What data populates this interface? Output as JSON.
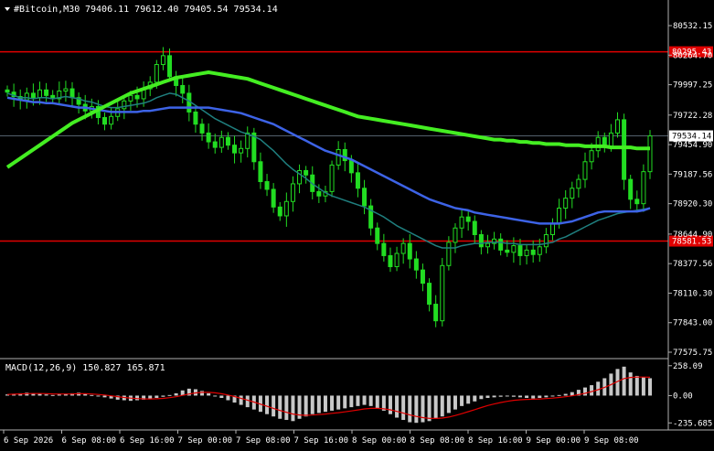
{
  "header": {
    "symbol": "#Bitcoin,M30",
    "ohlc": "79406.11 79612.40 79405.54 79534.14",
    "menu_icon": "triangle-down-icon"
  },
  "colors": {
    "background": "#000000",
    "grid": "#1c2a2a",
    "axis": "#b0b0b0",
    "text": "#ffffff",
    "candle": "#22dd22",
    "ma_fast": "#1f7f7f",
    "ma_mid": "#3d63e6",
    "ma_slow": "#44ee22",
    "hline": "#e00000",
    "price_label_bg": "#e00000",
    "macd_hist": "#c8c8c8",
    "macd_signal": "#e00000"
  },
  "chart_data": [
    {
      "type": "candlestick",
      "title": "#Bitcoin,M30",
      "y_ticks": [
        "80532.15",
        "80264.70",
        "79997.25",
        "79722.28",
        "79454.90",
        "79187.56",
        "78920.30",
        "78644.90",
        "78377.56",
        "78110.30",
        "77843.00",
        "77575.75"
      ],
      "ylim": [
        77575.75,
        80532.15
      ],
      "x_ticks": [
        "6 Sep 2026",
        "6 Sep 08:00",
        "6 Sep 16:00",
        "7 Sep 00:00",
        "7 Sep 08:00",
        "7 Sep 16:00",
        "8 Sep 00:00",
        "8 Sep 08:00",
        "8 Sep 16:00",
        "9 Sep 00:00",
        "9 Sep 08:00"
      ],
      "current_price": {
        "value": 79534.14,
        "label": "79534.14"
      },
      "horizontal_lines": [
        {
          "value": 80295.43,
          "label": "80295.43"
        },
        {
          "value": 78581.53,
          "label": "78581.53"
        }
      ],
      "price_path": [
        79930,
        79890,
        79860,
        79920,
        79880,
        79950,
        79900,
        79870,
        79940,
        79960,
        79880,
        79820,
        79760,
        79800,
        79700,
        79640,
        79710,
        79780,
        79850,
        79900,
        79870,
        79960,
        80020,
        80180,
        80260,
        80070,
        79990,
        79920,
        79750,
        79640,
        79560,
        79480,
        79430,
        79520,
        79450,
        79380,
        79420,
        79560,
        79300,
        79120,
        79050,
        78890,
        78810,
        78940,
        79100,
        79220,
        79180,
        79030,
        78990,
        79030,
        79270,
        79410,
        79310,
        79200,
        79060,
        78900,
        78700,
        78560,
        78450,
        78350,
        78470,
        78560,
        78420,
        78320,
        78200,
        78010,
        77860,
        78360,
        78570,
        78700,
        78800,
        78760,
        78640,
        78530,
        78560,
        78600,
        78500,
        78480,
        78540,
        78450,
        78500,
        78460,
        78530,
        78640,
        78740,
        78880,
        78970,
        79060,
        79140,
        79300,
        79400,
        79520,
        79440,
        79560,
        79680,
        79140,
        78960,
        78920,
        79210,
        79534
      ],
      "series": [
        {
          "name": "MA fast",
          "values": [
            79920,
            79900,
            79880,
            79880,
            79870,
            79880,
            79880,
            79870,
            79880,
            79890,
            79880,
            79870,
            79850,
            79840,
            79820,
            79800,
            79790,
            79790,
            79800,
            79810,
            79820,
            79830,
            79850,
            79880,
            79900,
            79920,
            79910,
            79880,
            79850,
            79810,
            79770,
            79730,
            79690,
            79660,
            79630,
            79600,
            79570,
            79550,
            79530,
            79500,
            79450,
            79400,
            79340,
            79280,
            79230,
            79190,
            79150,
            79100,
            79060,
            79020,
            78990,
            78970,
            78950,
            78930,
            78910,
            78890,
            78860,
            78830,
            78800,
            78760,
            78720,
            78690,
            78660,
            78630,
            78600,
            78570,
            78540,
            78520,
            78520,
            78520,
            78540,
            78550,
            78560,
            78560,
            78570,
            78570,
            78570,
            78560,
            78560,
            78550,
            78550,
            78550,
            78550,
            78560,
            78570,
            78600,
            78620,
            78650,
            78680,
            78710,
            78740,
            78770,
            78790,
            78810,
            78830,
            78840,
            78850,
            78860,
            78870,
            78880
          ]
        },
        {
          "name": "MA mid",
          "values": [
            79880,
            79870,
            79860,
            79850,
            79840,
            79840,
            79830,
            79830,
            79820,
            79810,
            79800,
            79790,
            79790,
            79780,
            79770,
            79760,
            79750,
            79750,
            79750,
            79750,
            79750,
            79760,
            79760,
            79770,
            79780,
            79790,
            79790,
            79790,
            79790,
            79790,
            79790,
            79790,
            79780,
            79770,
            79760,
            79750,
            79740,
            79720,
            79700,
            79680,
            79660,
            79640,
            79610,
            79580,
            79550,
            79520,
            79490,
            79460,
            79430,
            79400,
            79380,
            79360,
            79340,
            79320,
            79290,
            79260,
            79230,
            79200,
            79170,
            79140,
            79110,
            79080,
            79050,
            79020,
            78990,
            78960,
            78940,
            78920,
            78900,
            78880,
            78870,
            78860,
            78840,
            78830,
            78820,
            78810,
            78800,
            78790,
            78780,
            78770,
            78760,
            78750,
            78740,
            78740,
            78740,
            78740,
            78750,
            78760,
            78780,
            78800,
            78820,
            78840,
            78850,
            78850,
            78850,
            78850,
            78850,
            78850,
            78860,
            78880
          ]
        },
        {
          "name": "MA slow",
          "values": [
            79250,
            79290,
            79330,
            79370,
            79410,
            79450,
            79490,
            79530,
            79570,
            79610,
            79650,
            79680,
            79710,
            79740,
            79770,
            79800,
            79830,
            79860,
            79890,
            79920,
            79940,
            79960,
            79980,
            80000,
            80020,
            80040,
            80060,
            80070,
            80080,
            80090,
            80100,
            80110,
            80100,
            80090,
            80080,
            80070,
            80060,
            80050,
            80030,
            80010,
            79990,
            79970,
            79950,
            79930,
            79910,
            79890,
            79870,
            79850,
            79830,
            79810,
            79790,
            79770,
            79750,
            79730,
            79710,
            79700,
            79690,
            79680,
            79670,
            79660,
            79650,
            79640,
            79630,
            79620,
            79610,
            79600,
            79590,
            79580,
            79570,
            79560,
            79550,
            79540,
            79530,
            79520,
            79510,
            79500,
            79500,
            79490,
            79490,
            79480,
            79480,
            79470,
            79470,
            79460,
            79460,
            79460,
            79450,
            79450,
            79450,
            79440,
            79440,
            79440,
            79440,
            79430,
            79430,
            79430,
            79430,
            79420,
            79420,
            79420
          ]
        }
      ]
    },
    {
      "type": "bar",
      "title": "MACD(12,26,9) 150.827 165.871",
      "y_ticks": [
        "258.09",
        "0.00",
        "-235.685"
      ],
      "ylim": [
        -265,
        280
      ],
      "histogram": [
        10,
        15,
        20,
        25,
        20,
        15,
        10,
        5,
        10,
        15,
        20,
        25,
        15,
        5,
        -5,
        -15,
        -25,
        -35,
        -40,
        -45,
        -40,
        -35,
        -30,
        -20,
        -10,
        5,
        20,
        45,
        60,
        55,
        40,
        20,
        0,
        -20,
        -40,
        -60,
        -80,
        -100,
        -120,
        -140,
        -160,
        -180,
        -200,
        -210,
        -220,
        -200,
        -180,
        -160,
        -150,
        -140,
        -130,
        -120,
        -110,
        -100,
        -90,
        -80,
        -90,
        -110,
        -130,
        -160,
        -190,
        -210,
        -230,
        -235,
        -230,
        -220,
        -200,
        -180,
        -150,
        -120,
        -90,
        -70,
        -50,
        -30,
        -20,
        -15,
        -10,
        -5,
        -10,
        -15,
        -20,
        -25,
        -20,
        -15,
        -5,
        5,
        15,
        30,
        50,
        70,
        90,
        120,
        150,
        190,
        230,
        250,
        200,
        170,
        160,
        150
      ],
      "signal": [
        10,
        12,
        15,
        17,
        18,
        18,
        17,
        15,
        14,
        14,
        15,
        17,
        16,
        14,
        10,
        5,
        -2,
        -9,
        -16,
        -22,
        -26,
        -28,
        -29,
        -27,
        -24,
        -18,
        -10,
        2,
        14,
        23,
        28,
        28,
        24,
        16,
        5,
        -8,
        -23,
        -39,
        -56,
        -74,
        -92,
        -110,
        -128,
        -144,
        -159,
        -167,
        -170,
        -168,
        -164,
        -159,
        -153,
        -147,
        -140,
        -132,
        -124,
        -115,
        -110,
        -110,
        -114,
        -123,
        -136,
        -151,
        -167,
        -180,
        -190,
        -196,
        -197,
        -194,
        -185,
        -172,
        -156,
        -139,
        -121,
        -103,
        -86,
        -72,
        -60,
        -49,
        -41,
        -36,
        -33,
        -31,
        -29,
        -26,
        -22,
        -16,
        -10,
        -2,
        8,
        20,
        34,
        51,
        71,
        95,
        122,
        147,
        157,
        160,
        160,
        158
      ]
    }
  ]
}
